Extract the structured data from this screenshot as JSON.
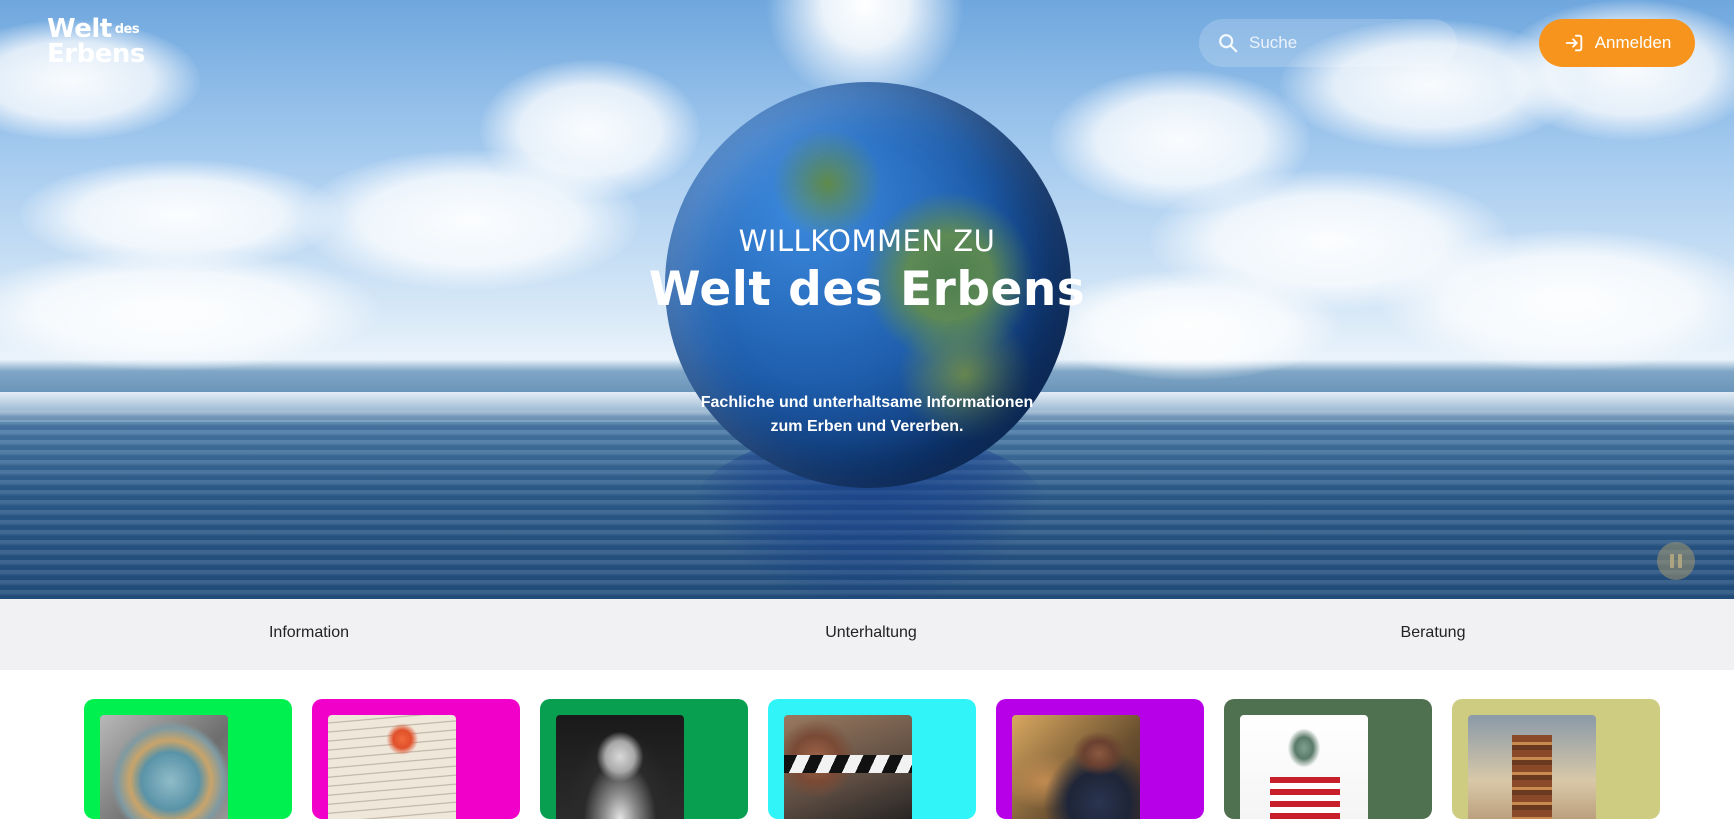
{
  "header": {
    "logo_line1": "Welt",
    "logo_small": "des",
    "logo_line2": "Erbens",
    "search_placeholder": "Suche",
    "login_label": "Anmelden"
  },
  "hero": {
    "welcome": "WILLKOMMEN ZU",
    "brand": "Welt des Erbens",
    "tagline_line1": "Fachliche und unterhaltsame Informationen",
    "tagline_line2": "zum Erben und Vererben."
  },
  "nav": {
    "items": [
      {
        "label": "Information"
      },
      {
        "label": "Unterhaltung"
      },
      {
        "label": "Beratung"
      }
    ]
  },
  "cards": [
    {
      "color": "#00f050",
      "image": "globe-photo"
    },
    {
      "color": "#f000c8",
      "image": "handwritten-book-photo"
    },
    {
      "color": "#08a050",
      "image": "elderly-man-portrait-photo"
    },
    {
      "color": "#30f4f8",
      "image": "film-clapperboard-photo"
    },
    {
      "color": "#b800e8",
      "image": "press-interview-photo"
    },
    {
      "color": "#4f7150",
      "image": "usa-landmarks-photo"
    },
    {
      "color": "#cdcc80",
      "image": "book-stack-photo"
    }
  ],
  "colors": {
    "accent": "#f7941d",
    "nav_bg": "#f1f1f3"
  }
}
